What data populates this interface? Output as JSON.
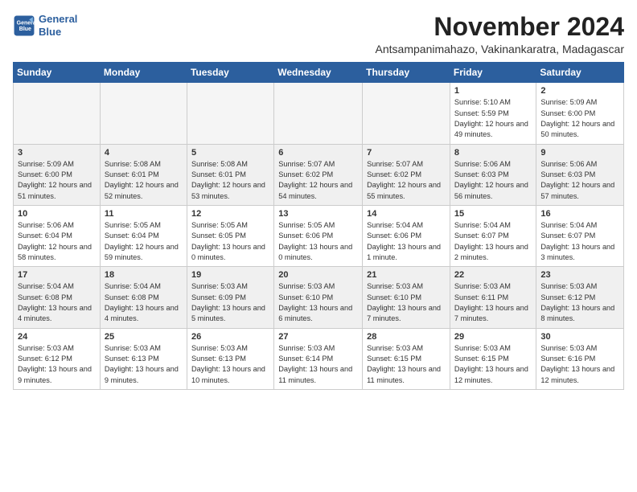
{
  "logo": {
    "line1": "General",
    "line2": "Blue"
  },
  "title": "November 2024",
  "location": "Antsampanimahazo, Vakinankaratra, Madagascar",
  "days_of_week": [
    "Sunday",
    "Monday",
    "Tuesday",
    "Wednesday",
    "Thursday",
    "Friday",
    "Saturday"
  ],
  "weeks": [
    [
      {
        "day": "",
        "empty": true
      },
      {
        "day": "",
        "empty": true
      },
      {
        "day": "",
        "empty": true
      },
      {
        "day": "",
        "empty": true
      },
      {
        "day": "",
        "empty": true
      },
      {
        "day": "1",
        "sunrise": "5:10 AM",
        "sunset": "5:59 PM",
        "daylight": "12 hours and 49 minutes."
      },
      {
        "day": "2",
        "sunrise": "5:09 AM",
        "sunset": "6:00 PM",
        "daylight": "12 hours and 50 minutes."
      }
    ],
    [
      {
        "day": "3",
        "sunrise": "5:09 AM",
        "sunset": "6:00 PM",
        "daylight": "12 hours and 51 minutes."
      },
      {
        "day": "4",
        "sunrise": "5:08 AM",
        "sunset": "6:01 PM",
        "daylight": "12 hours and 52 minutes."
      },
      {
        "day": "5",
        "sunrise": "5:08 AM",
        "sunset": "6:01 PM",
        "daylight": "12 hours and 53 minutes."
      },
      {
        "day": "6",
        "sunrise": "5:07 AM",
        "sunset": "6:02 PM",
        "daylight": "12 hours and 54 minutes."
      },
      {
        "day": "7",
        "sunrise": "5:07 AM",
        "sunset": "6:02 PM",
        "daylight": "12 hours and 55 minutes."
      },
      {
        "day": "8",
        "sunrise": "5:06 AM",
        "sunset": "6:03 PM",
        "daylight": "12 hours and 56 minutes."
      },
      {
        "day": "9",
        "sunrise": "5:06 AM",
        "sunset": "6:03 PM",
        "daylight": "12 hours and 57 minutes."
      }
    ],
    [
      {
        "day": "10",
        "sunrise": "5:06 AM",
        "sunset": "6:04 PM",
        "daylight": "12 hours and 58 minutes."
      },
      {
        "day": "11",
        "sunrise": "5:05 AM",
        "sunset": "6:04 PM",
        "daylight": "12 hours and 59 minutes."
      },
      {
        "day": "12",
        "sunrise": "5:05 AM",
        "sunset": "6:05 PM",
        "daylight": "13 hours and 0 minutes."
      },
      {
        "day": "13",
        "sunrise": "5:05 AM",
        "sunset": "6:06 PM",
        "daylight": "13 hours and 0 minutes."
      },
      {
        "day": "14",
        "sunrise": "5:04 AM",
        "sunset": "6:06 PM",
        "daylight": "13 hours and 1 minute."
      },
      {
        "day": "15",
        "sunrise": "5:04 AM",
        "sunset": "6:07 PM",
        "daylight": "13 hours and 2 minutes."
      },
      {
        "day": "16",
        "sunrise": "5:04 AM",
        "sunset": "6:07 PM",
        "daylight": "13 hours and 3 minutes."
      }
    ],
    [
      {
        "day": "17",
        "sunrise": "5:04 AM",
        "sunset": "6:08 PM",
        "daylight": "13 hours and 4 minutes."
      },
      {
        "day": "18",
        "sunrise": "5:04 AM",
        "sunset": "6:08 PM",
        "daylight": "13 hours and 4 minutes."
      },
      {
        "day": "19",
        "sunrise": "5:03 AM",
        "sunset": "6:09 PM",
        "daylight": "13 hours and 5 minutes."
      },
      {
        "day": "20",
        "sunrise": "5:03 AM",
        "sunset": "6:10 PM",
        "daylight": "13 hours and 6 minutes."
      },
      {
        "day": "21",
        "sunrise": "5:03 AM",
        "sunset": "6:10 PM",
        "daylight": "13 hours and 7 minutes."
      },
      {
        "day": "22",
        "sunrise": "5:03 AM",
        "sunset": "6:11 PM",
        "daylight": "13 hours and 7 minutes."
      },
      {
        "day": "23",
        "sunrise": "5:03 AM",
        "sunset": "6:12 PM",
        "daylight": "13 hours and 8 minutes."
      }
    ],
    [
      {
        "day": "24",
        "sunrise": "5:03 AM",
        "sunset": "6:12 PM",
        "daylight": "13 hours and 9 minutes."
      },
      {
        "day": "25",
        "sunrise": "5:03 AM",
        "sunset": "6:13 PM",
        "daylight": "13 hours and 9 minutes."
      },
      {
        "day": "26",
        "sunrise": "5:03 AM",
        "sunset": "6:13 PM",
        "daylight": "13 hours and 10 minutes."
      },
      {
        "day": "27",
        "sunrise": "5:03 AM",
        "sunset": "6:14 PM",
        "daylight": "13 hours and 11 minutes."
      },
      {
        "day": "28",
        "sunrise": "5:03 AM",
        "sunset": "6:15 PM",
        "daylight": "13 hours and 11 minutes."
      },
      {
        "day": "29",
        "sunrise": "5:03 AM",
        "sunset": "6:15 PM",
        "daylight": "13 hours and 12 minutes."
      },
      {
        "day": "30",
        "sunrise": "5:03 AM",
        "sunset": "6:16 PM",
        "daylight": "13 hours and 12 minutes."
      }
    ]
  ]
}
